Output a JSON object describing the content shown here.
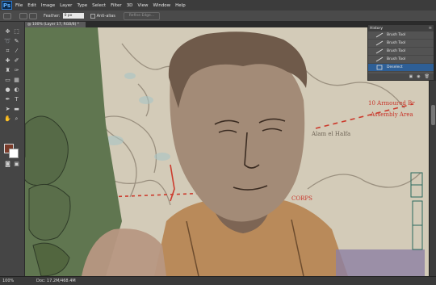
{
  "app": {
    "logo": "Ps"
  },
  "menu": [
    "File",
    "Edit",
    "Image",
    "Layer",
    "Type",
    "Select",
    "Filter",
    "3D",
    "View",
    "Window",
    "Help"
  ],
  "options": {
    "feather_label": "Feather:",
    "feather_value": "0 px",
    "antialias_label": "Anti-alias",
    "refine_label": "Refine Edge..."
  },
  "document": {
    "tab": "@ 100% (Layer 17, RGB/8) *"
  },
  "canvas": {
    "label_armoured": "10 Armoured Br",
    "label_assembly": "Assembly Area",
    "label_alam": "Alam el Halfa",
    "label_corps": "CORPS"
  },
  "history": {
    "title": "History",
    "menu_icon": "≡",
    "items": [
      {
        "label": "Brush Tool"
      },
      {
        "label": "Brush Tool"
      },
      {
        "label": "Brush Tool"
      },
      {
        "label": "Brush Tool"
      },
      {
        "label": "Deselect"
      }
    ]
  },
  "status": {
    "zoom": "100%",
    "docinfo": "Doc: 17.2M/468.4M"
  },
  "colors": {
    "foreground": "#7a3b2a",
    "background": "#ffffff",
    "highlight": "#2e5f96"
  },
  "tools": [
    "move-icon",
    "marquee-icon",
    "lasso-icon",
    "quick-select-icon",
    "crop-icon",
    "eyedropper-icon",
    "healing-icon",
    "brush-icon",
    "stamp-icon",
    "history-brush-icon",
    "eraser-icon",
    "gradient-icon",
    "blur-icon",
    "dodge-icon",
    "pen-icon",
    "type-icon",
    "path-select-icon",
    "shape-icon",
    "hand-icon",
    "zoom-icon"
  ]
}
